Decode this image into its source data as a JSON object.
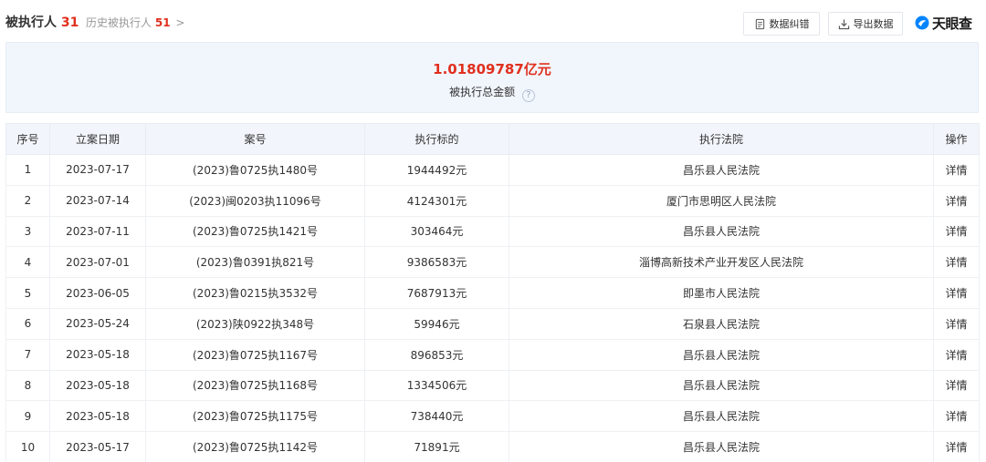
{
  "header": {
    "title": "被执行人",
    "title_count": "31",
    "history_label": "历史被执行人",
    "history_count": "51",
    "history_chevron": ">",
    "error_button": "数据纠错",
    "export_button": "导出数据",
    "brand_name": "天眼查"
  },
  "summary": {
    "amount": "1.01809787亿元",
    "label": "被执行总金额",
    "help_glyph": "?"
  },
  "table": {
    "columns": [
      "序号",
      "立案日期",
      "案号",
      "执行标的",
      "执行法院",
      "操作"
    ],
    "rows": [
      {
        "index": "1",
        "date": "2023-07-17",
        "case_no": "(2023)鲁0725执1480号",
        "amount": "1944492元",
        "court": "昌乐县人民法院",
        "action": "详情"
      },
      {
        "index": "2",
        "date": "2023-07-14",
        "case_no": "(2023)闽0203执11096号",
        "amount": "4124301元",
        "court": "厦门市思明区人民法院",
        "action": "详情"
      },
      {
        "index": "3",
        "date": "2023-07-11",
        "case_no": "(2023)鲁0725执1421号",
        "amount": "303464元",
        "court": "昌乐县人民法院",
        "action": "详情"
      },
      {
        "index": "4",
        "date": "2023-07-01",
        "case_no": "(2023)鲁0391执821号",
        "amount": "9386583元",
        "court": "淄博高新技术产业开发区人民法院",
        "action": "详情"
      },
      {
        "index": "5",
        "date": "2023-06-05",
        "case_no": "(2023)鲁0215执3532号",
        "amount": "7687913元",
        "court": "即墨市人民法院",
        "action": "详情"
      },
      {
        "index": "6",
        "date": "2023-05-24",
        "case_no": "(2023)陕0922执348号",
        "amount": "59946元",
        "court": "石泉县人民法院",
        "action": "详情"
      },
      {
        "index": "7",
        "date": "2023-05-18",
        "case_no": "(2023)鲁0725执1167号",
        "amount": "896853元",
        "court": "昌乐县人民法院",
        "action": "详情"
      },
      {
        "index": "8",
        "date": "2023-05-18",
        "case_no": "(2023)鲁0725执1168号",
        "amount": "1334506元",
        "court": "昌乐县人民法院",
        "action": "详情"
      },
      {
        "index": "9",
        "date": "2023-05-18",
        "case_no": "(2023)鲁0725执1175号",
        "amount": "738440元",
        "court": "昌乐县人民法院",
        "action": "详情"
      },
      {
        "index": "10",
        "date": "2023-05-17",
        "case_no": "(2023)鲁0725执1142号",
        "amount": "71891元",
        "court": "昌乐县人民法院",
        "action": "详情"
      }
    ]
  },
  "colors": {
    "accent_red": "#e0301e",
    "link_blue": "#0084ff",
    "summary_bg": "#f1f6fd",
    "header_bg": "#f2f6fc"
  },
  "icons": {
    "error_button": "document-icon",
    "export_button": "download-icon",
    "brand": "tianyancha-logo-icon",
    "help": "question-circle-icon"
  }
}
